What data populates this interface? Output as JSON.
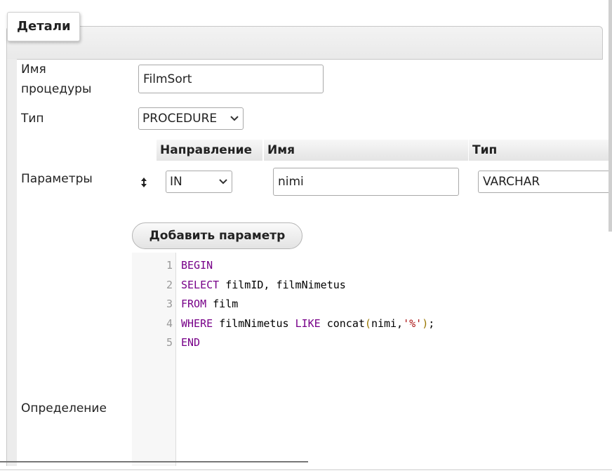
{
  "details_legend": "Детали",
  "form": {
    "name_label": "Имя процедуры",
    "name_value": "FilmSort",
    "type_label": "Тип",
    "type_value": "PROCEDURE",
    "params_label": "Параметры",
    "definition_label": "Определение"
  },
  "params_table": {
    "headers": [
      "Направление",
      "Имя",
      "Тип"
    ],
    "rows": [
      {
        "direction": "IN",
        "name": "nimi",
        "type": "VARCHAR"
      }
    ]
  },
  "add_param_button": "Добавить параметр",
  "editor": {
    "line_numbers": [
      "1",
      "2",
      "3",
      "4",
      "5"
    ],
    "lines": [
      "BEGIN",
      "SELECT filmID, filmNimetus",
      "FROM film",
      "WHERE filmNimetus LIKE concat(nimi,'%');",
      "END"
    ]
  },
  "icons": [
    "chevron-down-icon",
    "drag-handle-icon"
  ]
}
